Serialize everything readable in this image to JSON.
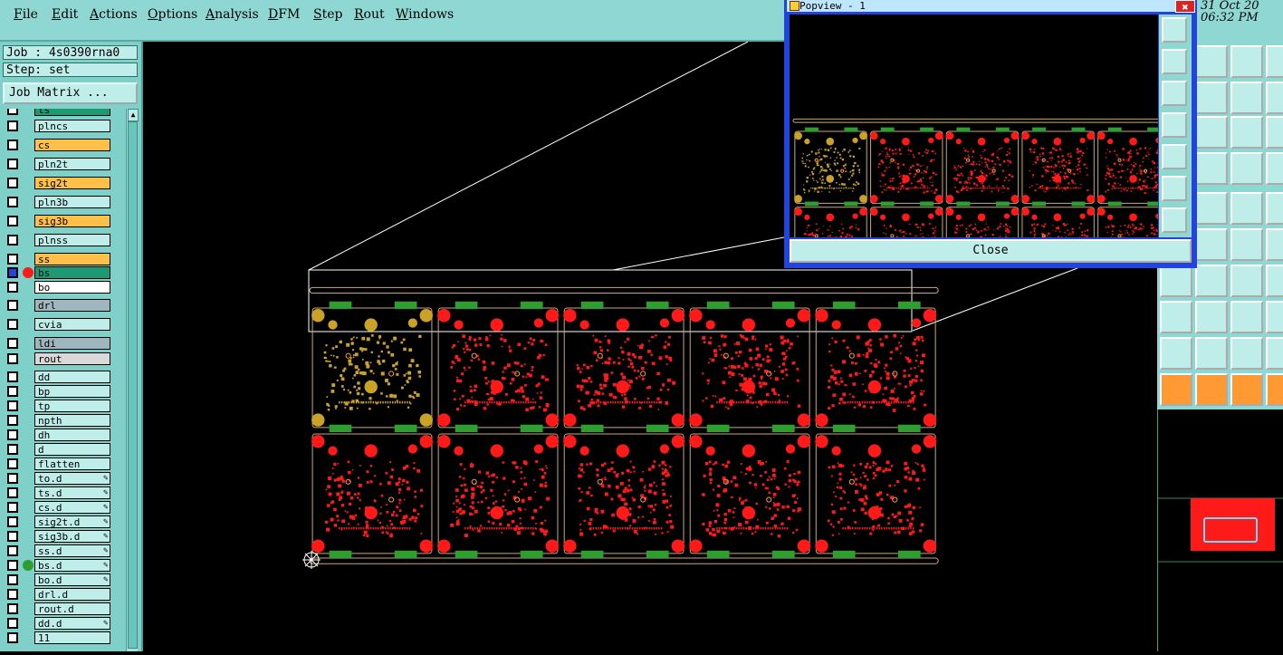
{
  "menu": [
    "File",
    "Edit",
    "Actions",
    "Options",
    "Analysis",
    "DFM",
    "Step",
    "Rout",
    "Windows"
  ],
  "job": {
    "job_label": "Job : 4s0390rna0",
    "step_label": "Step: set",
    "matrix_button": "Job Matrix ..."
  },
  "layers": [
    {
      "name": "ts",
      "color": "#1d9a73"
    },
    {
      "name": "plncs",
      "color": "#bfeeea"
    },
    {
      "name": "cs",
      "color": "#ffc04a"
    },
    {
      "name": "pln2t",
      "color": "#bfeeea"
    },
    {
      "name": "sig2t",
      "color": "#ffc04a"
    },
    {
      "name": "pln3b",
      "color": "#bfeeea"
    },
    {
      "name": "sig3b",
      "color": "#ffc04a"
    },
    {
      "name": "plnss",
      "color": "#bfeeea"
    },
    {
      "name": "ss",
      "color": "#ffc04a"
    },
    {
      "name": "bs",
      "color": "#1d9a73",
      "dot": "#ff1a1a",
      "selected": true
    },
    {
      "name": "bo",
      "color": "#ffffff"
    },
    {
      "name": "drl",
      "color": "#9fb6bf"
    },
    {
      "name": "cvia",
      "color": "#bfeeea"
    },
    {
      "name": "ldi",
      "color": "#9fb6bf"
    },
    {
      "name": "rout",
      "color": "#d9d9d9"
    },
    {
      "name": "dd",
      "color": "#bfeeea"
    },
    {
      "name": "bp",
      "color": "#bfeeea"
    },
    {
      "name": "tp",
      "color": "#bfeeea"
    },
    {
      "name": "npth",
      "color": "#bfeeea"
    },
    {
      "name": "dh",
      "color": "#bfeeea"
    },
    {
      "name": "d",
      "color": "#bfeeea"
    },
    {
      "name": "flatten",
      "color": "#bfeeea"
    },
    {
      "name": "to.d",
      "color": "#bfeeea",
      "mark": "✎"
    },
    {
      "name": "ts.d",
      "color": "#bfeeea",
      "mark": "✎"
    },
    {
      "name": "cs.d",
      "color": "#bfeeea",
      "mark": "✎"
    },
    {
      "name": "sig2t.d",
      "color": "#bfeeea",
      "mark": "✎"
    },
    {
      "name": "sig3b.d",
      "color": "#bfeeea",
      "mark": "✎"
    },
    {
      "name": "ss.d",
      "color": "#bfeeea",
      "mark": "✎"
    },
    {
      "name": "bs.d",
      "color": "#bfeeea",
      "dot": "#2e9e2e",
      "mark": "✎"
    },
    {
      "name": "bo.d",
      "color": "#bfeeea",
      "mark": "✎"
    },
    {
      "name": "drl.d",
      "color": "#bfeeea"
    },
    {
      "name": "rout.d",
      "color": "#bfeeea"
    },
    {
      "name": "dd.d",
      "color": "#bfeeea",
      "mark": "✎"
    },
    {
      "name": "11",
      "color": "#bfeeea"
    }
  ],
  "popview": {
    "title": "Popview - 1",
    "close_x": "✖",
    "close_button": "Close"
  },
  "clock": {
    "date": "31 Oct 20",
    "time": "06:32 PM"
  },
  "colors": {
    "pad": "#ff1a1a",
    "gold": "#c9a227",
    "tab": "#2e9e2e",
    "outline": "#c8a87a"
  }
}
